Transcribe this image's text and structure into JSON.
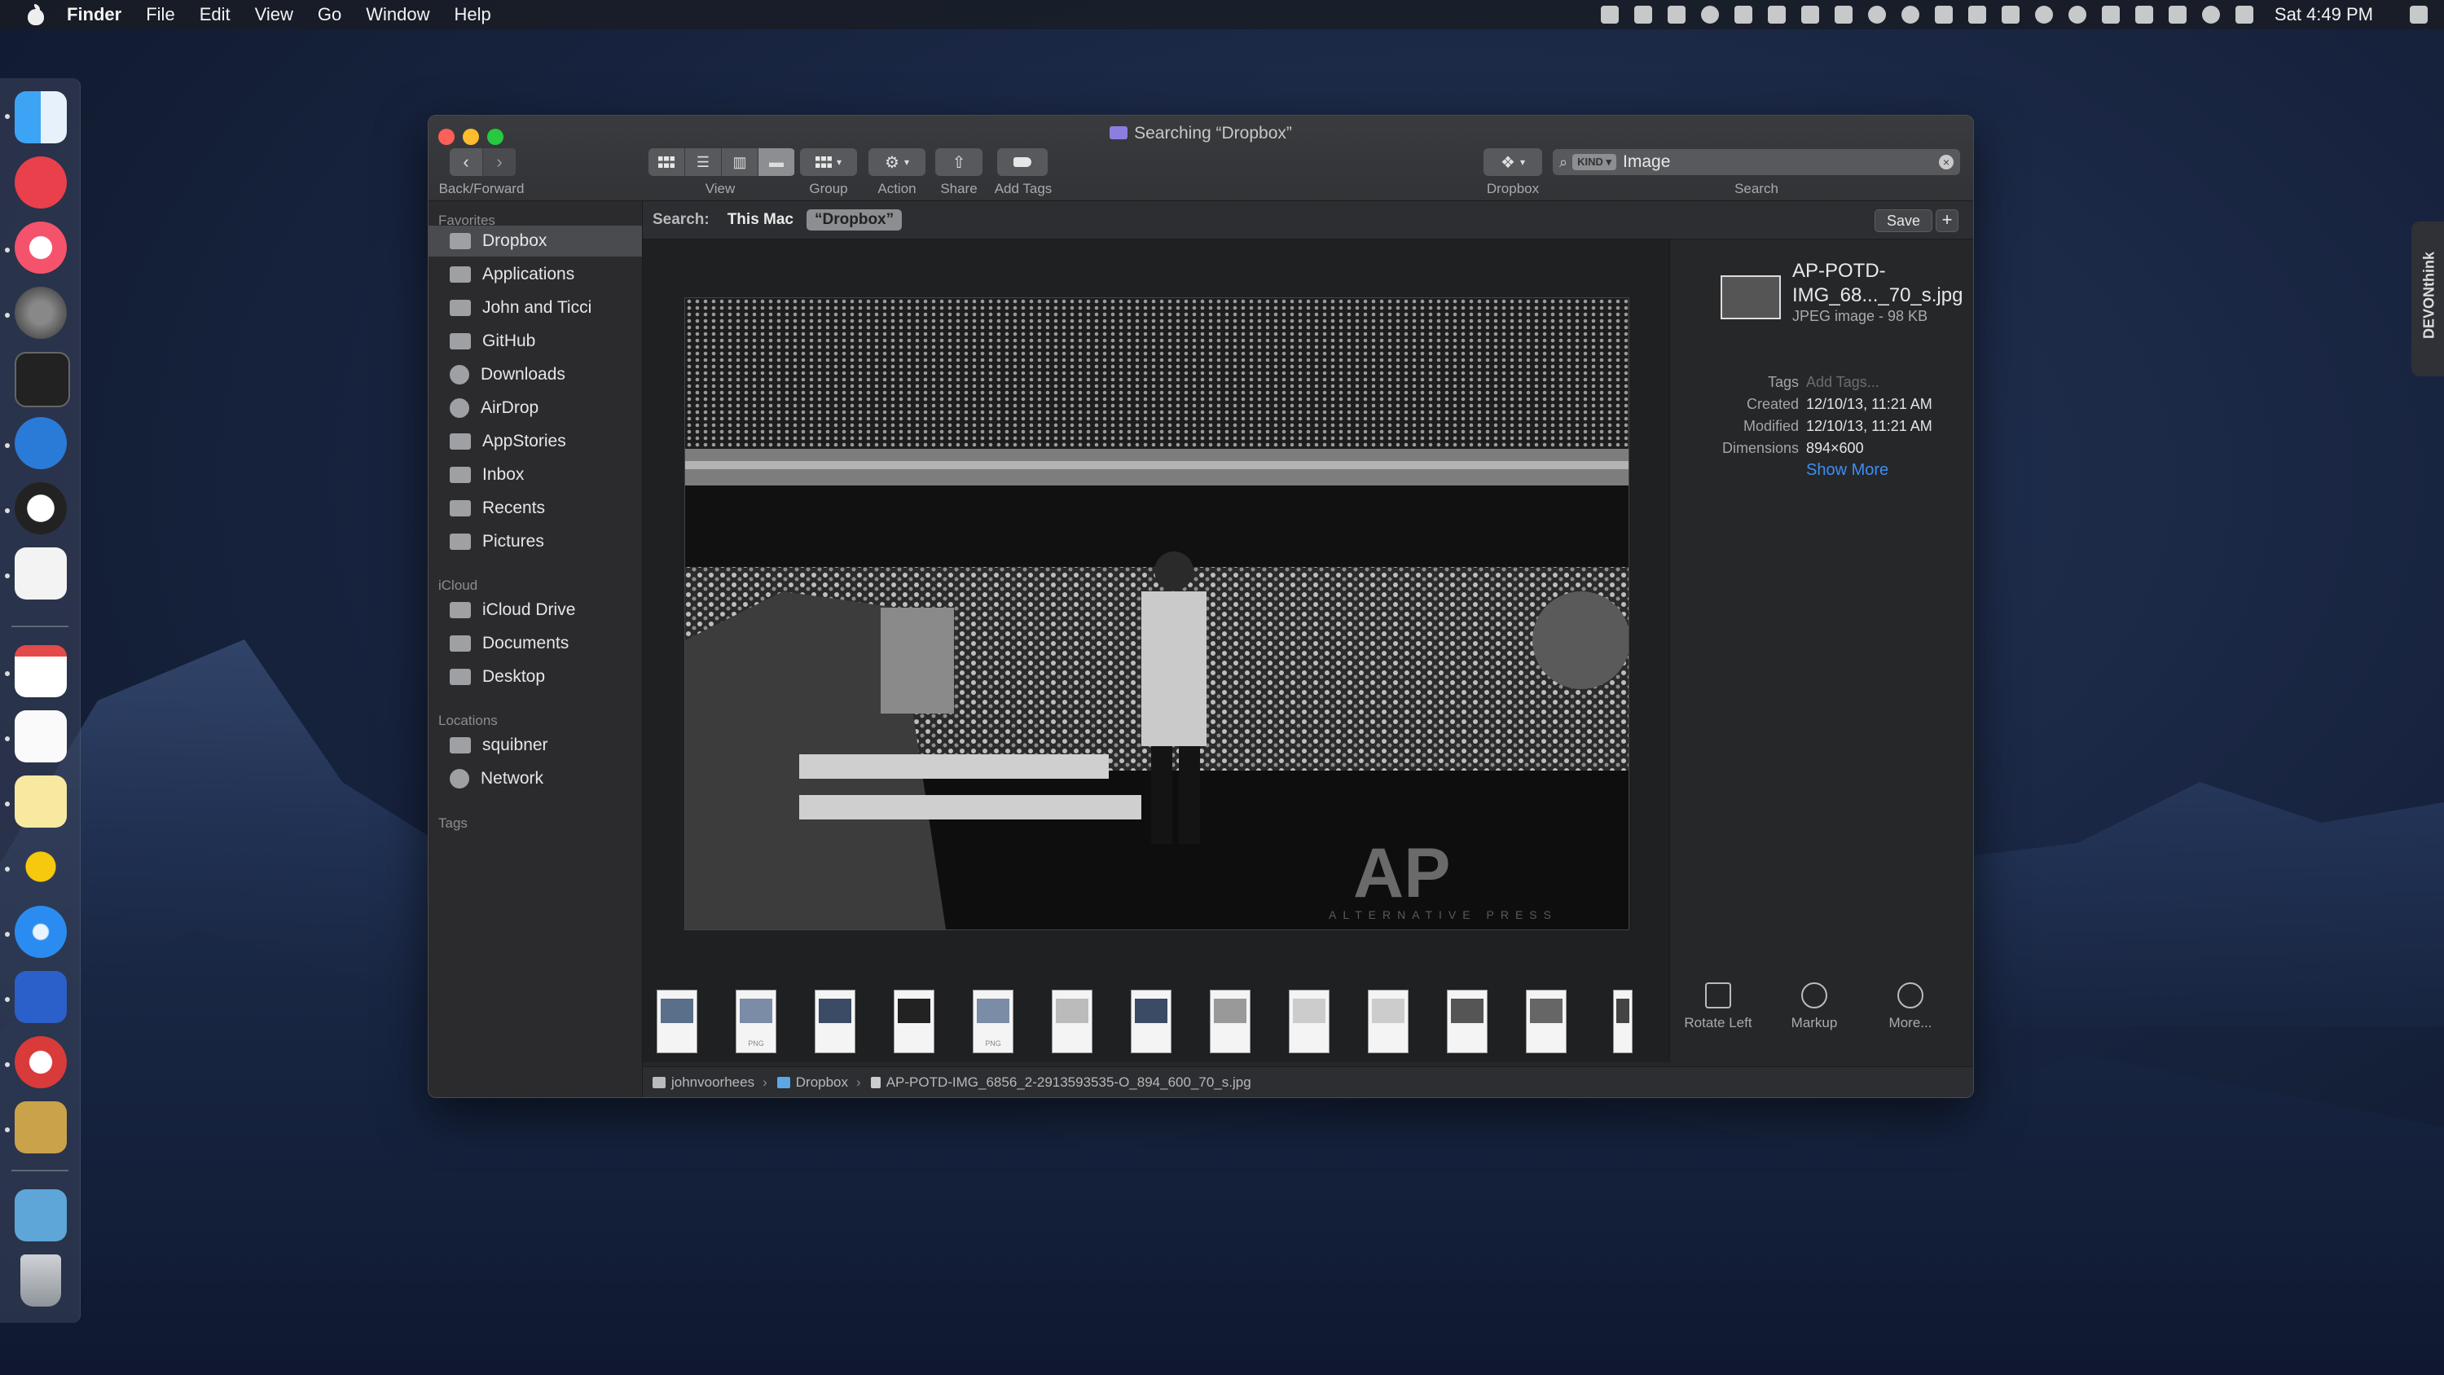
{
  "menubar": {
    "app": "Finder",
    "items": [
      "File",
      "Edit",
      "View",
      "Go",
      "Window",
      "Help"
    ],
    "clock": "Sat 4:49 PM"
  },
  "window": {
    "title": "Searching “Dropbox”",
    "toolbar": {
      "back_forward_label": "Back/Forward",
      "view_label": "View",
      "group_label": "Group",
      "action_label": "Action",
      "share_label": "Share",
      "add_tags_label": "Add Tags",
      "dropbox_label": "Dropbox",
      "search_label": "Search",
      "search_token": "KIND",
      "search_value": "Image"
    },
    "sidebar": {
      "favorites_header": "Favorites",
      "favorites": [
        "Dropbox",
        "Applications",
        "John and Ticci",
        "GitHub",
        "Downloads",
        "AirDrop",
        "AppStories",
        "Inbox",
        "Recents",
        "Pictures"
      ],
      "icloud_header": "iCloud",
      "icloud": [
        "iCloud Drive",
        "Documents",
        "Desktop"
      ],
      "locations_header": "Locations",
      "locations": [
        "squibner",
        "Network"
      ],
      "tags_header": "Tags"
    },
    "scope": {
      "label": "Search:",
      "this_mac": "This Mac",
      "dropbox": "“Dropbox”",
      "save": "Save",
      "plus": "+"
    },
    "info": {
      "filename": "AP-POTD-IMG_68..._70_s.jpg",
      "kind": "JPEG image - 98 KB",
      "tags_key": "Tags",
      "tags_value": "Add Tags...",
      "created_key": "Created",
      "created_value": "12/10/13, 11:21 AM",
      "modified_key": "Modified",
      "modified_value": "12/10/13, 11:21 AM",
      "dimensions_key": "Dimensions",
      "dimensions_value": "894×600",
      "show_more": "Show More"
    },
    "actions": [
      "Rotate Left",
      "Markup",
      "More..."
    ],
    "thumb_labels": [
      "",
      "PNG",
      "",
      "",
      "PNG",
      "",
      "",
      "",
      "",
      "",
      "",
      "",
      ""
    ],
    "path": {
      "home": "johnvoorhees",
      "folder": "Dropbox",
      "file": "AP-POTD-IMG_6856_2-2913593535-O_894_600_70_s.jpg"
    },
    "photo_watermark": "AP",
    "photo_watermark_sub": "ALTERNATIVE PRESS"
  },
  "devon": "DEVONthink",
  "colors": {
    "accent": "#3d8ef5",
    "sidebar_selection": "#4a4b4f",
    "close": "#fe5f57",
    "minimize": "#febc2e",
    "zoom": "#28c840"
  }
}
